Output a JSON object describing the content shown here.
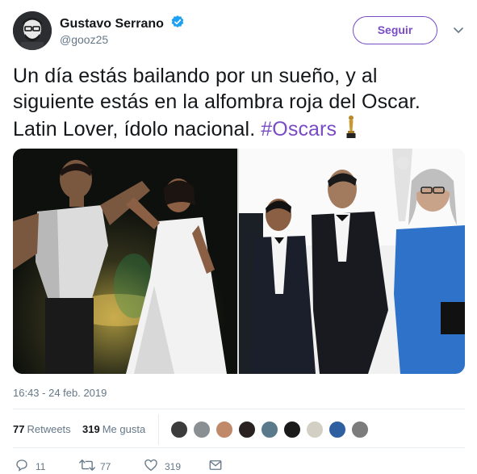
{
  "user": {
    "name": "Gustavo Serrano",
    "handle": "@gooz25",
    "follow_label": "Seguir"
  },
  "tweet": {
    "text_line1": "Un día estás bailando por un sueño, y al",
    "text_line2": "siguiente estás en la alfombra roja del Oscar.",
    "text_line3": "Latin Lover, ídolo nacional.",
    "hashtag": "#Oscars"
  },
  "media": {
    "left_image": "dancing-couple-photo",
    "right_image": "red-carpet-oscars-photo"
  },
  "timestamp": "16:43 - 24 feb. 2019",
  "stats": {
    "retweets_count": "77",
    "retweets_label": "Retweets",
    "likes_count": "319",
    "likes_label": "Me gusta"
  },
  "actions": {
    "reply_count": "11",
    "retweet_count": "77",
    "like_count": "319"
  },
  "colors": {
    "accent": "#794bc4",
    "verified": "#1da1f2",
    "muted": "#657786"
  }
}
